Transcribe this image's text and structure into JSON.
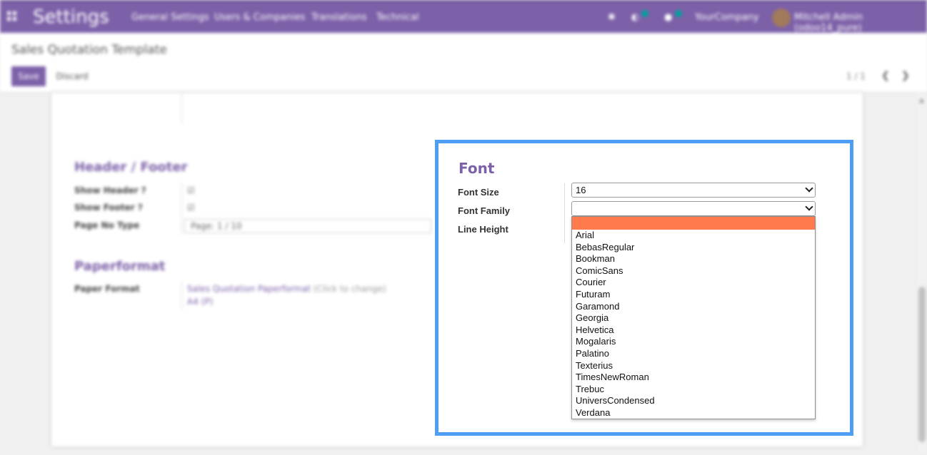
{
  "topbar": {
    "app_title": "Settings",
    "menu": [
      "General Settings",
      "Users & Companies",
      "Translations",
      "Technical"
    ],
    "company": "YourCompany",
    "user": "Mitchell Admin (odoo14_pure)"
  },
  "control": {
    "breadcrumb": "Sales Quotation Template",
    "save_label": "Save",
    "discard_label": "Discard",
    "pager": "1 / 1"
  },
  "sheet": {
    "header_footer": {
      "title": "Header / Footer",
      "fields": [
        {
          "label": "Show Header ?",
          "value": "☑"
        },
        {
          "label": "Show Footer ?",
          "value": "☑"
        },
        {
          "label": "Page No Type",
          "value": "Page: 1 / 10"
        }
      ]
    },
    "paperformat": {
      "title": "Paperformat",
      "label": "Paper Format",
      "link": "Sales Quotation Paperformat",
      "hint": "(Click to change)",
      "sub": "A4 (P)"
    }
  },
  "font_panel": {
    "title": "Font",
    "font_size_label": "Font Size",
    "font_size_value": "16",
    "font_family_label": "Font Family",
    "font_family_value": "",
    "line_height_label": "Line Height",
    "font_family_options": [
      "",
      "Arial",
      "BebasRegular",
      "Bookman",
      "ComicSans",
      "Courier",
      "Futuram",
      "Garamond",
      "Georgia",
      "Helvetica",
      "Mogalaris",
      "Palatino",
      "Texterius",
      "TimesNewRoman",
      "Trebuc",
      "UniversCondensed",
      "Verdana"
    ],
    "selected_option_color": "#ff7b4c",
    "highlight_border_color": "#4e9ef5",
    "accent_color": "#7c60a8"
  }
}
